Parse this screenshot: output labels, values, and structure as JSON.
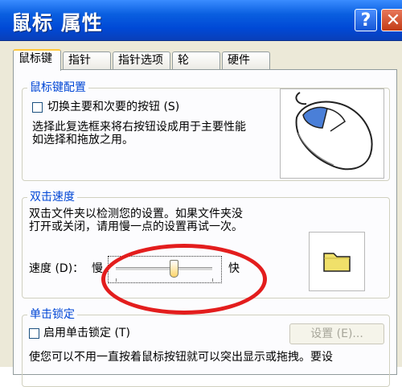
{
  "window": {
    "title": "鼠标 属性",
    "help_glyph": "?",
    "close_glyph": "✕"
  },
  "tabs": [
    {
      "label": "鼠标键",
      "active": true
    },
    {
      "label": "指针",
      "active": false
    },
    {
      "label": "指针选项",
      "active": false
    },
    {
      "label": "轮",
      "active": false
    },
    {
      "label": "硬件",
      "active": false
    }
  ],
  "button_config": {
    "legend": "鼠标键配置",
    "switch_checkbox_label": "切换主要和次要的按钮 (S)",
    "switch_checked": false,
    "description_line1": "选择此复选框来将右按钮设成用于主要性能",
    "description_line2": "如选择和拖放之用。"
  },
  "double_click": {
    "legend": "双击速度",
    "description_line1": "双击文件夹以检测您的设置。如果文件夹没",
    "description_line2": "打开或关闭，请用慢一点的设置再试一次。",
    "speed_label": "速度 (D)：",
    "slow_label": "慢",
    "fast_label": "快",
    "speed_fraction": 0.6
  },
  "click_lock": {
    "legend": "单击锁定",
    "enable_checkbox_label": "启用单击锁定 (T)",
    "enable_checked": false,
    "settings_button": "设置 (E)...",
    "description_line1": "使您可以不用一直按着鼠标按钮就可以突出显示或拖拽。要设"
  },
  "colors": {
    "title_bar": "#0a5fe0",
    "legend_text": "#0046d5",
    "highlight_circle": "#e31d1d",
    "folder": "#f0e06a",
    "mouse_button": "#4a7fd8"
  },
  "icons": {
    "mouse_image": "mouse-icon",
    "folder_image": "folder-icon"
  }
}
